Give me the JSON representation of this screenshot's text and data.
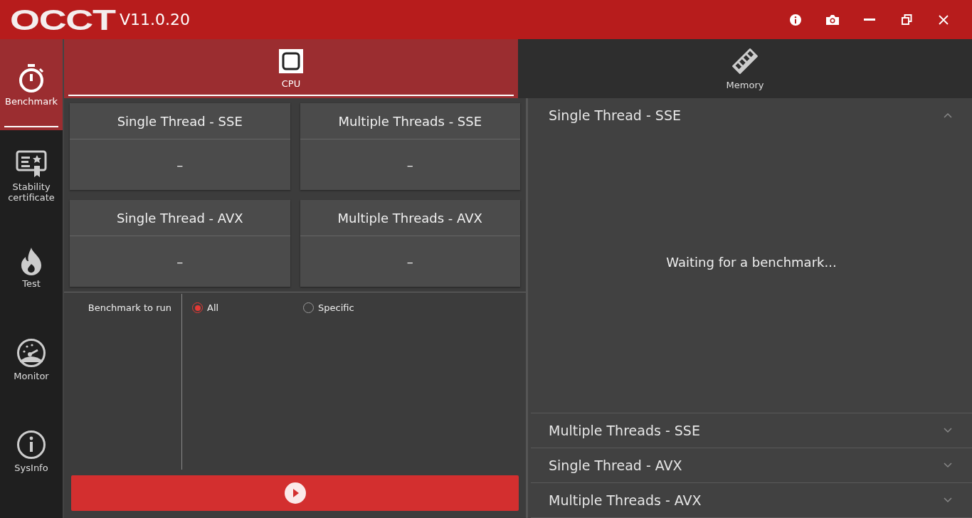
{
  "window": {
    "logo": "OCCT",
    "version": "V11.0.20"
  },
  "sidebar": {
    "items": [
      {
        "label": "Benchmark",
        "selected": true
      },
      {
        "label": "Stability certificate",
        "selected": false
      },
      {
        "label": "Test",
        "selected": false
      },
      {
        "label": "Monitor",
        "selected": false
      },
      {
        "label": "SysInfo",
        "selected": false
      }
    ]
  },
  "tabs": [
    {
      "label": "CPU",
      "selected": true
    },
    {
      "label": "Memory",
      "selected": false
    }
  ],
  "results": [
    {
      "title": "Single Thread - SSE",
      "value": "–"
    },
    {
      "title": "Multiple Threads - SSE",
      "value": "–"
    },
    {
      "title": "Single Thread - AVX",
      "value": "–"
    },
    {
      "title": "Multiple Threads - AVX",
      "value": "–"
    }
  ],
  "benchmark_to_run": {
    "label": "Benchmark to run",
    "options": [
      {
        "label": "All",
        "selected": true
      },
      {
        "label": "Specific",
        "selected": false
      }
    ]
  },
  "sections": [
    {
      "title": "Single Thread - SSE",
      "expanded": true,
      "message": "Waiting for a benchmark..."
    },
    {
      "title": "Multiple Threads - SSE",
      "expanded": false
    },
    {
      "title": "Single Thread - AVX",
      "expanded": false
    },
    {
      "title": "Multiple Threads - AVX",
      "expanded": false
    }
  ]
}
